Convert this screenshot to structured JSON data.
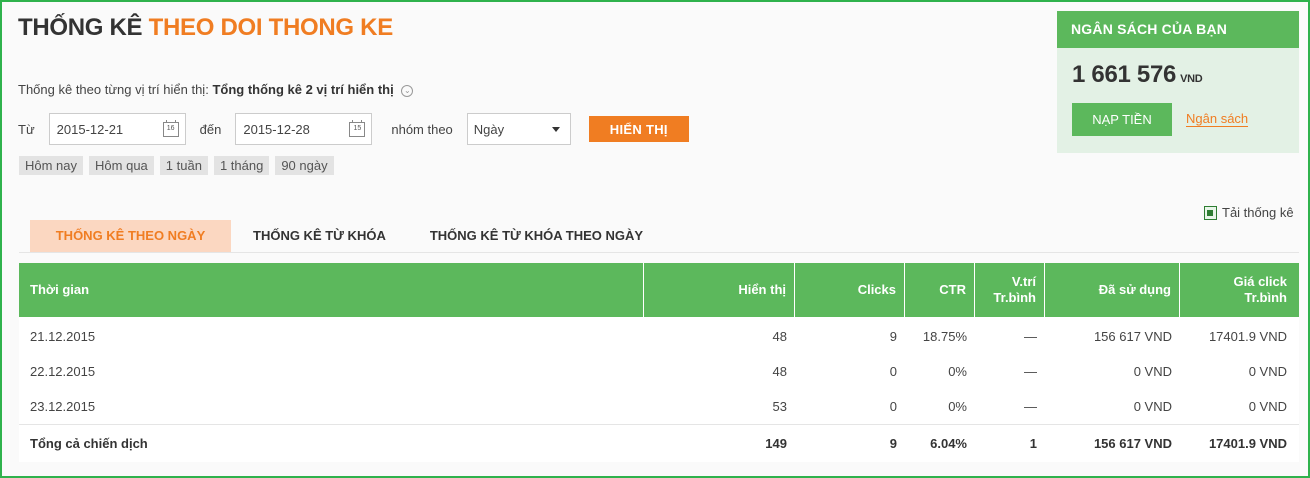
{
  "header": {
    "title_prefix": "THỐNG KÊ",
    "title_campaign": "THEO DOI THONG KE"
  },
  "position": {
    "label": "Thống kê theo từng vị trí hiển thị:",
    "value": "Tổng thống kê 2 vị trí hiển thị"
  },
  "filters": {
    "from_label": "Từ",
    "from_value": "2015-12-21",
    "from_calendar_day": "16",
    "to_label": "đến",
    "to_value": "2015-12-28",
    "to_calendar_day": "15",
    "group_label": "nhóm theo",
    "group_value": "Ngày",
    "show_button": "HIỂN THỊ",
    "quick_ranges": [
      "Hôm nay",
      "Hôm qua",
      "1 tuần",
      "1 tháng",
      "90 ngày"
    ]
  },
  "budget": {
    "title": "NGÂN SÁCH CỦA BẠN",
    "amount": "1 661 576",
    "currency": "VND",
    "topup_button": "NẠP TIỀN",
    "budget_link": "Ngân sách"
  },
  "download_label": "Tải thống kê",
  "tabs": [
    {
      "label": "THỐNG KÊ THEO NGÀY",
      "active": true
    },
    {
      "label": "THỐNG KÊ TỪ KHÓA",
      "active": false
    },
    {
      "label": "THỐNG KÊ TỪ KHÓA THEO NGÀY",
      "active": false
    }
  ],
  "table": {
    "columns": [
      "Thời gian",
      "Hiển thị",
      "Clicks",
      "CTR",
      "V.trí\nTr.bình",
      "Đã sử dụng",
      "Giá click\nTr.bình"
    ],
    "rows": [
      [
        "21.12.2015",
        "48",
        "9",
        "18.75%",
        "—",
        "156 617 VND",
        "17401.9 VND"
      ],
      [
        "22.12.2015",
        "48",
        "0",
        "0%",
        "—",
        "0 VND",
        "0 VND"
      ],
      [
        "23.12.2015",
        "53",
        "0",
        "0%",
        "—",
        "0 VND",
        "0 VND"
      ]
    ],
    "total": [
      "Tổng cả chiến dịch",
      "149",
      "9",
      "6.04%",
      "1",
      "156 617 VND",
      "17401.9 VND"
    ]
  },
  "colors": {
    "accent_orange": "#f07d22",
    "accent_green": "#5cb85c",
    "frame_border": "#2fb24c"
  }
}
